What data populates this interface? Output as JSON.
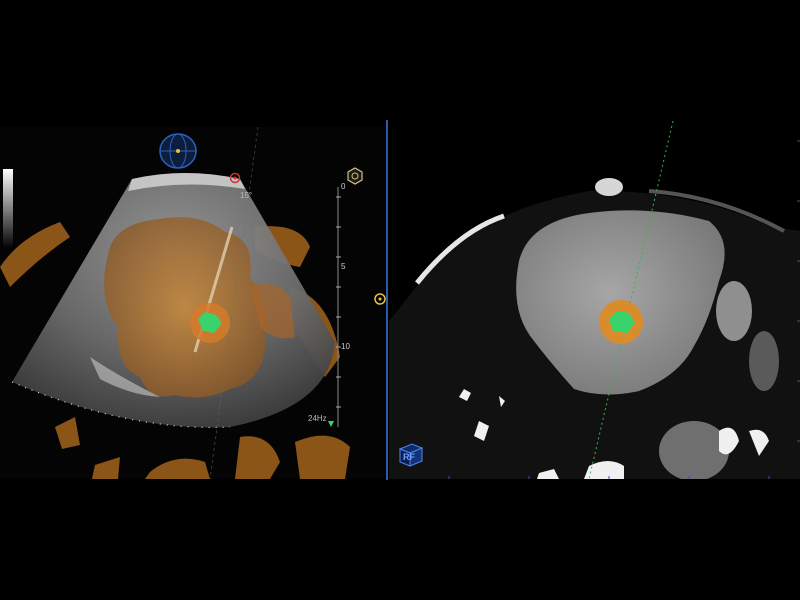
{
  "left_view": {
    "angle_label": "15°",
    "frequency_label": "24Hz",
    "depth_scale": [
      "0",
      "5",
      "10"
    ]
  },
  "right_view": {
    "corner_badge": "RF"
  },
  "icons": {
    "orientation": "globe-orientation-icon",
    "target": "target-marker-icon",
    "hexagon": "hexagon-probe-icon",
    "view_cube": "view-cube-icon"
  },
  "colors": {
    "overlay_orange": "#c9792a",
    "ablation_green": "#38d36a",
    "divider_blue": "#2a5aa8",
    "marker_yellow": "#e8c33a"
  }
}
